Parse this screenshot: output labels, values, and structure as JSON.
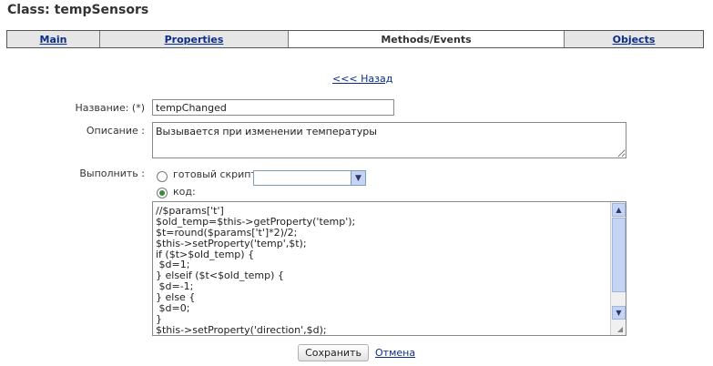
{
  "header": {
    "class_label": "Class:",
    "class_name": "tempSensors"
  },
  "tabs": [
    {
      "label": "Main",
      "active": false
    },
    {
      "label": "Properties",
      "active": false
    },
    {
      "label": "Methods/Events",
      "active": true
    },
    {
      "label": "Objects",
      "active": false
    }
  ],
  "nav": {
    "back_label": "<<< Назад"
  },
  "form": {
    "name_label": "Название: (*)",
    "name_value": "tempChanged",
    "description_label": "Описание :",
    "description_value": "Вызывается при изменении температуры",
    "execute_label": "Выполнить :",
    "option_script_label": "готовый скрипт:",
    "option_code_label": "код:",
    "selected_option": "code",
    "script_select_value": "",
    "code_lines": [
      "//$params['t']",
      "$old_temp=$this->getProperty('temp');",
      "$t=round($params['t']*2)/2;",
      "$this->setProperty('temp',$t);",
      "if ($t>$old_temp) {",
      " $d=1;",
      "} elseif ($t<$old_temp) {",
      " $d=-1;",
      "} else {",
      " $d=0;",
      "}",
      "$this->setProperty('direction',$d);"
    ]
  },
  "actions": {
    "save_label": "Сохранить",
    "cancel_label": "Отмена"
  },
  "colors": {
    "link": "#0b2d8a",
    "radio_checked": "#3a8a3a",
    "scrollbar": "#c4d4f5"
  }
}
